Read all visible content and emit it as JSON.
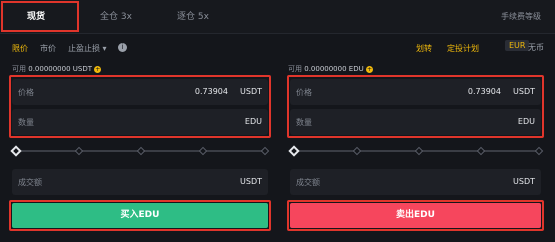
{
  "tabs": [
    {
      "label": "现货"
    },
    {
      "label": "全仓 3x"
    },
    {
      "label": "逐仓 5x"
    }
  ],
  "fee_link": "手续费等级",
  "order_types": {
    "limit": "限价",
    "market": "市价",
    "stop_limit": "止盈止损",
    "dropdown_arrow": "▾"
  },
  "right_links": {
    "convert": "划转",
    "auto_invest": "定投计划"
  },
  "currency": {
    "badge": "EUR",
    "label": "无币"
  },
  "buy": {
    "available_label": "可用",
    "available_value": "0.00000000 USDT",
    "price_label": "价格",
    "price_value": "0.73904",
    "price_unit": "USDT",
    "qty_label": "数量",
    "qty_unit": "EDU",
    "total_label": "成交额",
    "total_unit": "USDT",
    "button": "买入EDU"
  },
  "sell": {
    "available_label": "可用",
    "available_value": "0.00000000 EDU",
    "price_label": "价格",
    "price_value": "0.73904",
    "price_unit": "USDT",
    "qty_label": "数量",
    "qty_unit": "EDU",
    "total_label": "成交额",
    "total_unit": "USDT",
    "button": "卖出EDU"
  },
  "colors": {
    "accent": "#f0b90b",
    "buy": "#2ebd85",
    "sell": "#f6465d",
    "highlight": "#e0352b"
  },
  "icons": {
    "info": "info-icon",
    "add": "plus-circle-icon",
    "slider_handle": "diamond-icon"
  }
}
